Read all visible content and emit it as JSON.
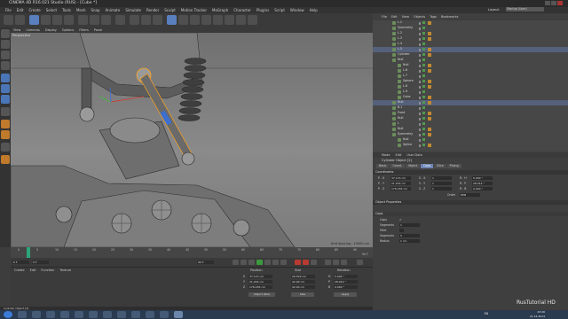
{
  "window": {
    "title": "CINEMA 4D R16.021 Studio (RUS) - [Cube *]"
  },
  "menubar": [
    "File",
    "Edit",
    "Create",
    "Select",
    "Tools",
    "Mesh",
    "Snap",
    "Animate",
    "Simulate",
    "Render",
    "Sculpt",
    "Motion Tracker",
    "MoGraph",
    "Character",
    "Plugins",
    "Script",
    "Window",
    "Help"
  ],
  "layout": {
    "label": "Layout:",
    "value": "Startup (User)"
  },
  "viewport": {
    "menu": [
      "View",
      "Cameras",
      "Display",
      "Options",
      "Filters",
      "Panel"
    ],
    "name": "Perspective",
    "grid_spacing": "Grid Spacing : 10000 cm"
  },
  "timeline": {
    "ticks": [
      "0",
      "5",
      "10",
      "15",
      "20",
      "25",
      "30",
      "35",
      "40",
      "45",
      "50",
      "55",
      "60",
      "65",
      "70",
      "75",
      "80",
      "85",
      "90"
    ],
    "start": "0 F",
    "current": "0 F",
    "end": "90 F",
    "end_field": "90 F"
  },
  "material_manager": {
    "menu": [
      "Create",
      "Edit",
      "Function",
      "Texture"
    ]
  },
  "coordinates": {
    "headers": {
      "position": "Position",
      "size": "Size",
      "rotation": "Rotation"
    },
    "rows": [
      {
        "axis": "X",
        "pos": "37.115 cm",
        "size": "20.529 cm",
        "rot_axis": "H",
        "rot": "5.000 °"
      },
      {
        "axis": "Y",
        "pos": "21.204 cm",
        "size": "42.00 cm",
        "rot_axis": "P",
        "rot": "28.914 °"
      },
      {
        "axis": "Z",
        "pos": "176.183 cm",
        "size": "42.00 cm",
        "rot_axis": "B",
        "rot": "0.000 °"
      }
    ],
    "object_mode": "Object (Rel)",
    "size_mode": "Size",
    "apply": "Apply"
  },
  "status": "Cylinder Object [2]",
  "object_manager": {
    "menu": [
      "File",
      "Edit",
      "View",
      "Objects",
      "Tags",
      "Bookmarks"
    ],
    "rows": [
      {
        "indent": 0,
        "name": "L.1",
        "selected": false
      },
      {
        "indent": 0,
        "name": "Symmetry",
        "selected": false
      },
      {
        "indent": 0,
        "name": "L.2",
        "selected": false
      },
      {
        "indent": 0,
        "name": "L.3",
        "selected": false
      },
      {
        "indent": 0,
        "name": "L.4",
        "selected": false
      },
      {
        "indent": 0,
        "name": "L.5",
        "selected": true
      },
      {
        "indent": 0,
        "name": "Cylinder",
        "selected": false
      },
      {
        "indent": 0,
        "name": "Null",
        "selected": false
      },
      {
        "indent": 1,
        "name": "Null",
        "selected": false
      },
      {
        "indent": 1,
        "name": "L.6",
        "selected": false
      },
      {
        "indent": 1,
        "name": "L.7",
        "selected": false
      },
      {
        "indent": 1,
        "name": "Sphere",
        "selected": false
      },
      {
        "indent": 1,
        "name": "L.8",
        "selected": false
      },
      {
        "indent": 1,
        "name": "L.9",
        "selected": false
      },
      {
        "indent": 1,
        "name": "Cube",
        "selected": false
      },
      {
        "indent": 0,
        "name": "Null",
        "selected": true
      },
      {
        "indent": 0,
        "name": "B.1",
        "selected": false
      },
      {
        "indent": 0,
        "name": "Front",
        "selected": false
      },
      {
        "indent": 0,
        "name": "Null",
        "selected": false
      },
      {
        "indent": 0,
        "name": "L",
        "selected": false
      },
      {
        "indent": 0,
        "name": "Null",
        "selected": false
      },
      {
        "indent": 0,
        "name": "Symmetry",
        "selected": false
      },
      {
        "indent": 1,
        "name": "Null",
        "selected": false
      },
      {
        "indent": 1,
        "name": "Spline",
        "selected": false
      }
    ]
  },
  "attributes": {
    "menu": [
      "Mode",
      "Edit",
      "User Data"
    ],
    "title": "Cylinder Object [2]",
    "tabs": [
      "Basic",
      "Coord.",
      "Object",
      "Caps",
      "Slice",
      "Phong"
    ],
    "active_tab": "Caps",
    "coord_section": "Coordinates",
    "coord_rows": [
      {
        "l1": "P . X",
        "v1": "37.115 cm",
        "l2": "S . X",
        "v2": "1",
        "l3": "R . H",
        "v3": "5.000 °"
      },
      {
        "l1": "P . Y",
        "v1": "21.204 cm",
        "l2": "S . Y",
        "v2": "1",
        "l3": "R . P",
        "v3": "28.914 °"
      },
      {
        "l1": "P . Z",
        "v1": "176.183 cm",
        "l2": "S . Z",
        "v2": "1",
        "l3": "R . B",
        "v3": "0.000 °"
      }
    ],
    "order_label": "Order",
    "order_value": "HPB",
    "props_section": "Object Properties",
    "caps_section": "Caps",
    "caps_rows": [
      {
        "label": "Caps",
        "value": "✔"
      },
      {
        "label": "Segments",
        "value": "1"
      },
      {
        "label": "Fillet",
        "value": ""
      },
      {
        "label": "Segments",
        "value": "5"
      },
      {
        "label": "Radius",
        "value": "1 cm"
      }
    ]
  },
  "taskbar": {
    "lang": "EN",
    "time": "23:26",
    "date": "21.12.2014"
  },
  "watermark": "RusTutorial HD",
  "colors": {
    "selection": "#55607a",
    "accent_blue": "#5a7fbf",
    "accent_orange": "#c07a2c",
    "viewport": "#7c7c7c"
  }
}
